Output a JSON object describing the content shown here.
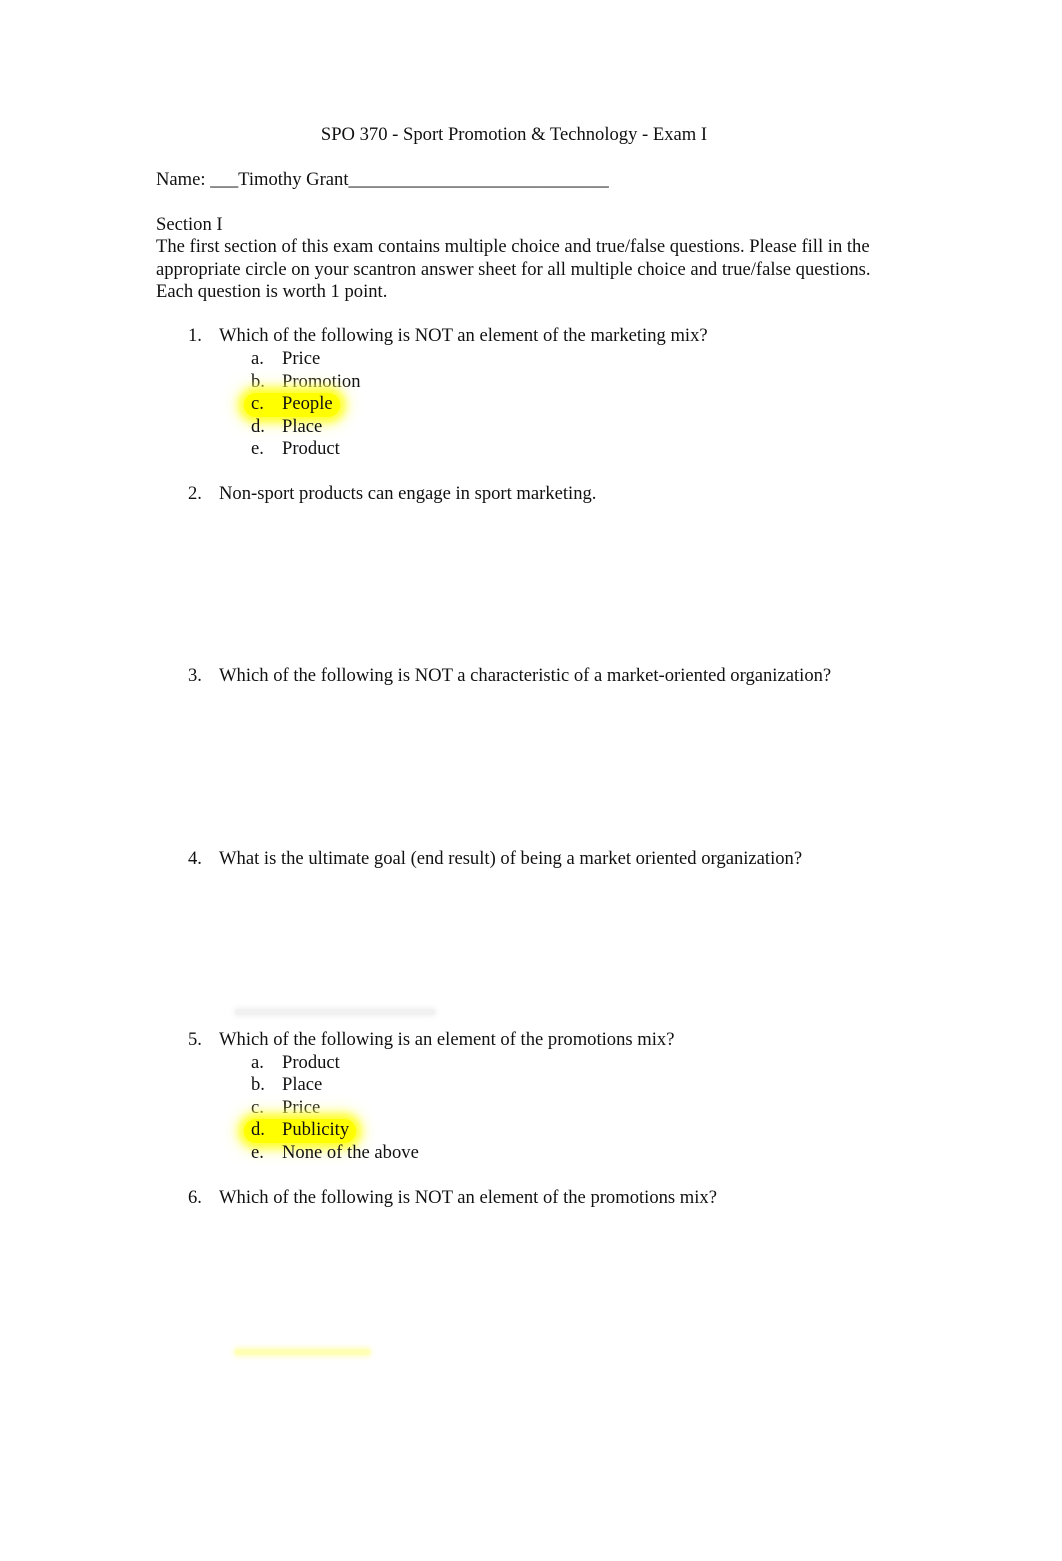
{
  "document": {
    "title": "SPO 370 - Sport Promotion & Technology - Exam I",
    "name_line": {
      "label": "Name: ",
      "prefix_blank": "___",
      "value": "Timothy Grant",
      "suffix_blank": "____________________________"
    },
    "section": {
      "heading": "Section I",
      "instructions": "The first section of this exam contains multiple choice and true/false questions. Please fill in the appropriate circle on your scantron answer sheet for all multiple choice and true/false questions. Each question is worth 1 point."
    },
    "highlight_color": "#ffff00",
    "questions": [
      {
        "number": "1.",
        "text": "Which of the following is NOT an element of the marketing mix?",
        "options": [
          {
            "letter": "a.",
            "text": "Price",
            "highlighted": false
          },
          {
            "letter": "b.",
            "text": "Promotion",
            "highlighted": false
          },
          {
            "letter": "c.",
            "text": "People",
            "highlighted": true
          },
          {
            "letter": "d.",
            "text": "Place",
            "highlighted": false
          },
          {
            "letter": "e.",
            "text": "Product",
            "highlighted": false
          }
        ]
      },
      {
        "number": "2.",
        "text": "Non-sport products can engage in sport marketing.",
        "options": []
      },
      {
        "number": "3.",
        "text": "Which of the following is NOT a characteristic of a market-oriented organization?",
        "options": []
      },
      {
        "number": "4.",
        "text": "What is the ultimate goal (end result) of being a market oriented organization?",
        "options": []
      },
      {
        "number": "5.",
        "text": "Which of the following is an element of the promotions mix?",
        "options": [
          {
            "letter": "a.",
            "text": "Product",
            "highlighted": false
          },
          {
            "letter": "b.",
            "text": "Place",
            "highlighted": false
          },
          {
            "letter": "c.",
            "text": "Price",
            "highlighted": false
          },
          {
            "letter": "d.",
            "text": "Publicity",
            "highlighted": true
          },
          {
            "letter": "e.",
            "text": "None of the above",
            "highlighted": false
          }
        ]
      },
      {
        "number": "6.",
        "text": "Which of the following is NOT an element of the promotions mix?",
        "options": []
      }
    ]
  }
}
